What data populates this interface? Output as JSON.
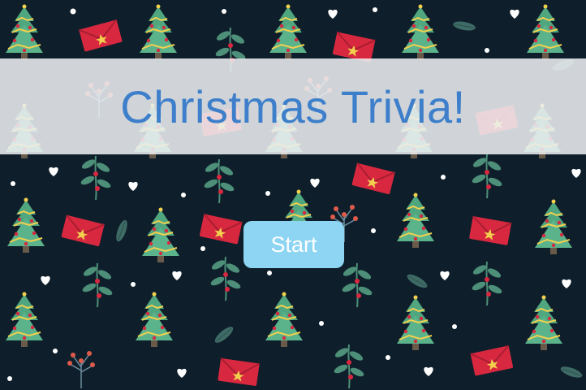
{
  "game": {
    "title": "Christmas Trivia!",
    "start_label": "Start"
  },
  "background": {
    "theme": "christmas-pattern",
    "base_color": "#0e1f2b",
    "motifs": [
      "christmas-tree-icon",
      "envelope-icon",
      "heart-icon",
      "mistletoe-icon",
      "berry-sprig-icon",
      "snow-dot-icon",
      "leaf-icon"
    ]
  },
  "colors": {
    "title": "#3d7fca",
    "banner": "#eceef0",
    "button": "#8dd5f2",
    "button_text": "#ffffff",
    "tree": "#4fa67f",
    "envelope": "#d8283f"
  }
}
